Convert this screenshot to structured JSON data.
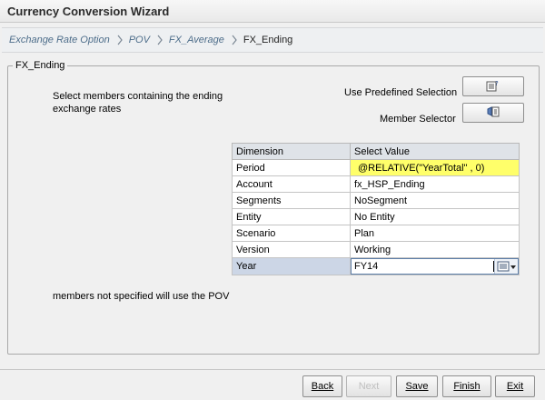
{
  "window": {
    "title": "Currency Conversion Wizard"
  },
  "breadcrumb": [
    {
      "label": "Exchange Rate Option",
      "current": false
    },
    {
      "label": "POV",
      "current": false
    },
    {
      "label": "FX_Average",
      "current": false
    },
    {
      "label": "FX_Ending",
      "current": true
    }
  ],
  "group": {
    "legend": "FX_Ending",
    "instruction": "Select members containing the ending exchange rates",
    "predefined_label": "Use Predefined Selection",
    "member_selector_label": "Member Selector",
    "footnote": "members not specified will use the POV"
  },
  "grid": {
    "headers": [
      "Dimension",
      "Select Value"
    ],
    "rows": [
      {
        "dimension": "Period",
        "value": "@RELATIVE(\"YearTotal\" , 0)"
      },
      {
        "dimension": "Account",
        "value": "fx_HSP_Ending"
      },
      {
        "dimension": "Segments",
        "value": "NoSegment"
      },
      {
        "dimension": "Entity",
        "value": "No Entity"
      },
      {
        "dimension": "Scenario",
        "value": "Plan"
      },
      {
        "dimension": "Version",
        "value": "Working"
      },
      {
        "dimension": "Year",
        "value": "FY14"
      }
    ]
  },
  "buttons": {
    "back": "Back",
    "next": "Next",
    "save": "Save",
    "finish": "Finish",
    "exit": "Exit"
  },
  "colors": {
    "highlight": "#ffff6a",
    "crumb_link": "#4d6d8a",
    "active_row": "#ccd6e6"
  }
}
